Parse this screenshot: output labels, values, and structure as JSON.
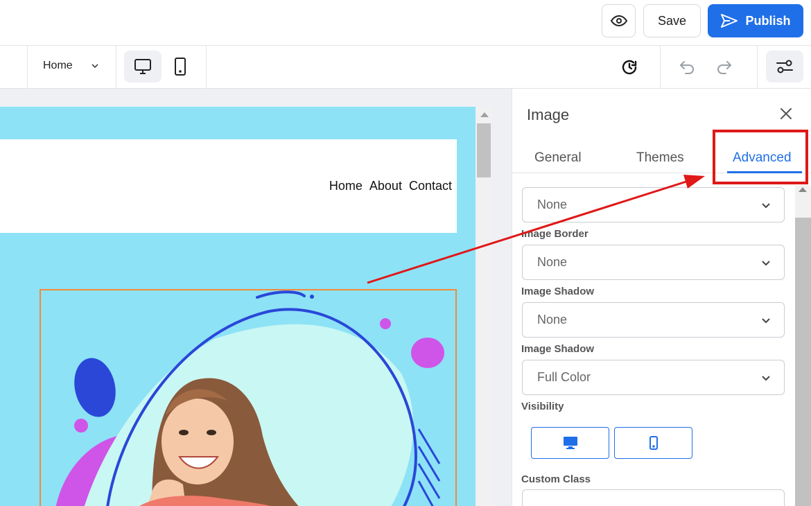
{
  "topbar": {
    "preview_icon": "eye-icon",
    "save_label": "Save",
    "publish_label": "Publish",
    "publish_icon": "send-icon",
    "accent": "#1f6fe8"
  },
  "toolbar": {
    "page_select": "Home",
    "device_desktop_icon": "monitor-icon",
    "device_mobile_icon": "smartphone-icon",
    "history_icon": "history-icon",
    "undo_icon": "undo-icon",
    "redo_icon": "redo-icon",
    "settings_icon": "sliders-icon"
  },
  "canvas": {
    "background": "#8de2f6",
    "nav": [
      "Home",
      "About",
      "Contact"
    ]
  },
  "panel": {
    "title": "Image",
    "tabs": [
      "General",
      "Themes",
      "Advanced"
    ],
    "active_tab": "Advanced",
    "fields": [
      {
        "label": "",
        "value": "None"
      },
      {
        "label": "Image Border",
        "value": "None"
      },
      {
        "label": "Image Shadow",
        "value": "None"
      },
      {
        "label": "Image Shadow",
        "value": "Full Color"
      }
    ],
    "visibility_label": "Visibility",
    "custom_class_label": "Custom Class",
    "custom_class_value": ""
  },
  "annotation": {
    "color": "#e01818"
  }
}
